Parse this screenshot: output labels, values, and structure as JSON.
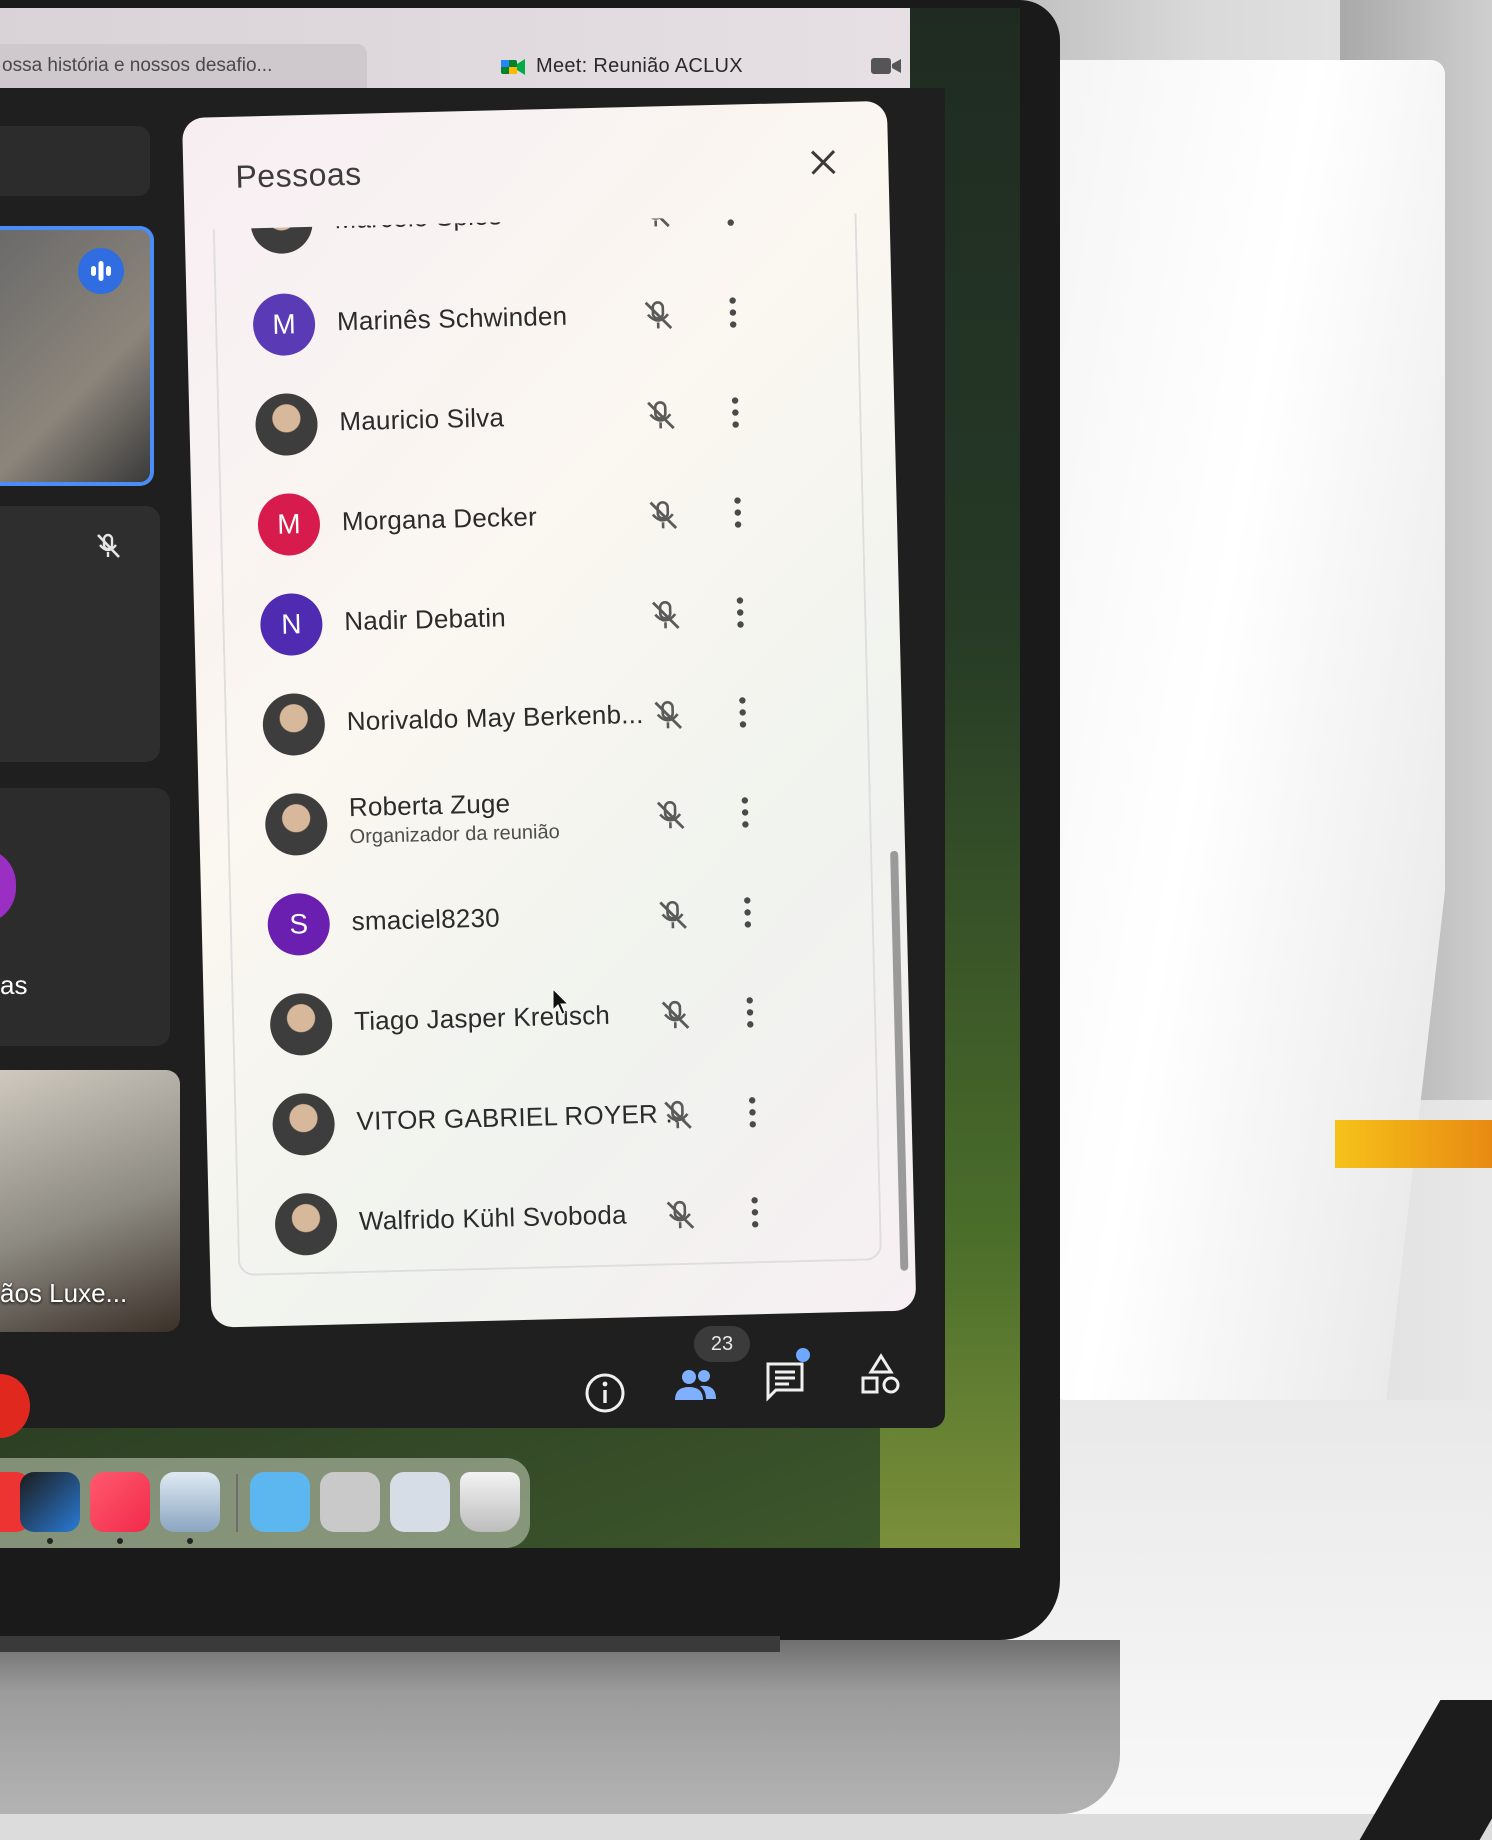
{
  "browser": {
    "prev_tab_title": "ossa história e nossos desafio...",
    "meet_tab_title": "Meet: Reunião ACLUX",
    "meet_logo_icon": "google-meet-icon",
    "camera_icon": "camera-icon"
  },
  "stage": {
    "tile_3_name": "as",
    "tile_4_name": "ãos Luxe..."
  },
  "panel": {
    "title": "Pessoas",
    "close_icon": "close-icon",
    "participants": [
      {
        "name": "Marcelo Spies",
        "avatar_type": "photo",
        "partial": true
      },
      {
        "name": "Marinês Schwinden",
        "avatar_type": "initial",
        "initial": "M",
        "color": "#5b3bb5"
      },
      {
        "name": "Mauricio Silva",
        "avatar_type": "photo"
      },
      {
        "name": "Morgana Decker",
        "avatar_type": "initial",
        "initial": "M",
        "color": "#d81b4d"
      },
      {
        "name": "Nadir Debatin",
        "avatar_type": "initial",
        "initial": "N",
        "color": "#4e2bb0"
      },
      {
        "name": "Norivaldo May Berkenb...",
        "avatar_type": "photo"
      },
      {
        "name": "Roberta Zuge",
        "subtitle": "Organizador da reunião",
        "avatar_type": "photo"
      },
      {
        "name": "smaciel8230",
        "avatar_type": "initial",
        "initial": "S",
        "color": "#6a1fb0"
      },
      {
        "name": "Tiago Jasper Kreusch",
        "avatar_type": "photo"
      },
      {
        "name": "VITOR GABRIEL ROYER ...",
        "avatar_type": "photo"
      },
      {
        "name": "Walfrido Kühl Svoboda",
        "avatar_type": "photo"
      }
    ]
  },
  "controls": {
    "participant_count": "23",
    "info_icon": "info-icon",
    "people_icon": "people-icon",
    "chat_icon": "chat-icon",
    "activities_icon": "activities-icon"
  },
  "colors": {
    "speaking_border": "#4a8df8",
    "end_call": "#e0281f",
    "panel_bg": "#f7f2f0"
  }
}
